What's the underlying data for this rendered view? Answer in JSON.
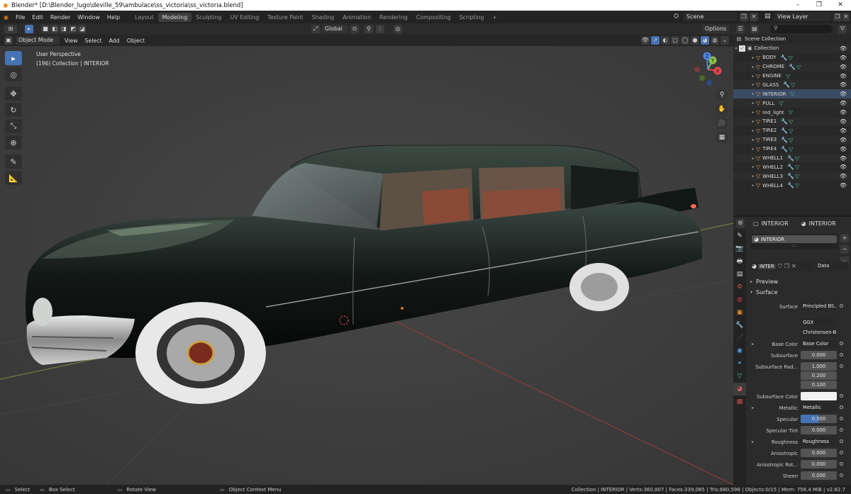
{
  "window": {
    "title": "Blender* [D:\\Blender_lugo\\deville_59\\ambulace\\ss_victoria\\ss_victoria.blend]",
    "minimize": "–",
    "maximize": "❐",
    "close": "✕"
  },
  "menubar": {
    "items": [
      "File",
      "Edit",
      "Render",
      "Window",
      "Help"
    ]
  },
  "workspaces": {
    "tabs": [
      "Layout",
      "Modeling",
      "Sculpting",
      "UV Editing",
      "Texture Paint",
      "Shading",
      "Animation",
      "Rendering",
      "Compositing",
      "Scripting"
    ],
    "active": "Modeling",
    "add": "+"
  },
  "scene": {
    "label": "Scene",
    "view_layer": "View Layer"
  },
  "viewport_header": {
    "transform_orientation": "Global",
    "options": "Options",
    "mode": "Object Mode",
    "menus": [
      "View",
      "Select",
      "Add",
      "Object"
    ]
  },
  "viewport": {
    "perspective": "User Perspective",
    "collection_info": "(196) Collection | INTERIOR",
    "gizmo_axes": {
      "x": "X",
      "y": "Y",
      "z": "Z"
    }
  },
  "outliner": {
    "root": "Scene Collection",
    "collection": "Collection",
    "objects": [
      {
        "name": "BODY",
        "wrench": true
      },
      {
        "name": "CHROME",
        "wrench": true
      },
      {
        "name": "ENGINE",
        "wrench": false
      },
      {
        "name": "GLASS",
        "wrench": true
      },
      {
        "name": "INTERIOR",
        "wrench": false,
        "selected": true
      },
      {
        "name": "PULL",
        "wrench": false
      },
      {
        "name": "red_light",
        "wrench": false
      },
      {
        "name": "TIRE1",
        "wrench": true
      },
      {
        "name": "TIRE2",
        "wrench": true
      },
      {
        "name": "TIRE3",
        "wrench": true
      },
      {
        "name": "TIRE4",
        "wrench": true
      },
      {
        "name": "WHELL1",
        "wrench": true
      },
      {
        "name": "WHELL2",
        "wrench": true
      },
      {
        "name": "WHELL3",
        "wrench": true
      },
      {
        "name": "WHELL4",
        "wrench": true
      }
    ]
  },
  "properties": {
    "object_name": "INTERIOR",
    "material_name": "INTERIOR",
    "slot_name": "INTERIOR",
    "slot_dots": "::::",
    "material_field": "INTER",
    "link": "Data",
    "panels": {
      "preview": "Preview",
      "surface": "Surface"
    },
    "rows": [
      {
        "label": "Surface",
        "value": "Principled BS...",
        "kind": "dd"
      },
      {
        "label": "",
        "value": "GGX",
        "kind": "dd"
      },
      {
        "label": "",
        "value": "Christensen-Bu...",
        "kind": "dd"
      },
      {
        "label": "Base Color",
        "value": "Base Color",
        "kind": "dd",
        "expand": true
      },
      {
        "label": "Subsurface",
        "value": "0.000",
        "kind": "num"
      },
      {
        "label": "Subsurface Rad...",
        "value": "1.000",
        "kind": "num"
      },
      {
        "label": "",
        "value": "0.200",
        "kind": "num"
      },
      {
        "label": "",
        "value": "0.100",
        "kind": "num"
      },
      {
        "label": "Subsurface Color",
        "value": "",
        "kind": "color"
      },
      {
        "label": "Metallic",
        "value": "Metallic",
        "kind": "dd",
        "expand": true
      },
      {
        "label": "Specular",
        "value": "0.500",
        "kind": "slider",
        "fraction": 0.5
      },
      {
        "label": "Specular Tint",
        "value": "0.000",
        "kind": "num"
      },
      {
        "label": "Roughness",
        "value": "Roughness",
        "kind": "dd",
        "expand": true
      },
      {
        "label": "Anisotropic",
        "value": "0.000",
        "kind": "num"
      },
      {
        "label": "Anisotropic Rot...",
        "value": "0.000",
        "kind": "num"
      },
      {
        "label": "Sheen",
        "value": "0.000",
        "kind": "num"
      }
    ]
  },
  "statusbar": {
    "select": "Select",
    "box_select": "Box Select",
    "rotate_view": "Rotate View",
    "context_menu": "Object Context Menu",
    "stats": "Collection | INTERIOR | Verts:360,807 | Faces:339,065 | Tris:680,598 | Objects:0/15 | Mem: 756.4 MiB | v2.82.7"
  },
  "colors": {
    "accent": "#4772b3",
    "background": "#3c3c3c",
    "panel": "#2b2b2b",
    "x_axis": "#e5484d",
    "y_axis": "#8bc34a",
    "z_axis": "#4f86e8"
  }
}
